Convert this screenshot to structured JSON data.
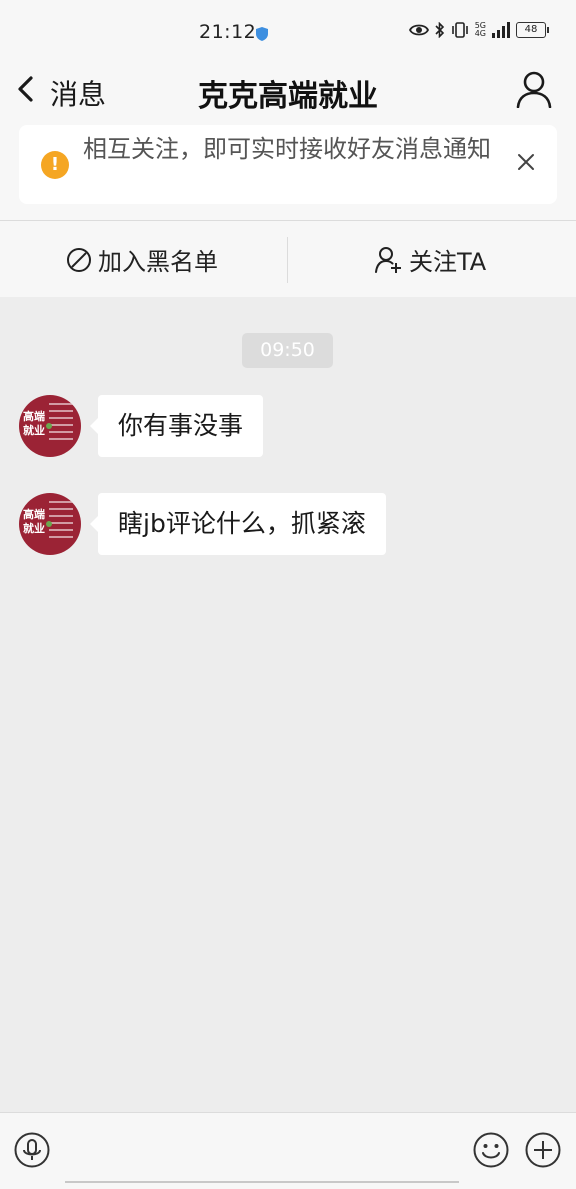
{
  "status_bar": {
    "time": "21:12",
    "network_label_top": "5G",
    "network_label_bottom": "4G",
    "battery": "48"
  },
  "nav": {
    "back_label": "消息",
    "title": "克克高端就业"
  },
  "notice": {
    "text": "相互关注，即可实时接收好友消息通知"
  },
  "actions": {
    "blacklist_label": "加入黑名单",
    "follow_label": "关注TA"
  },
  "chat": {
    "timestamp": "09:50",
    "messages": [
      {
        "text": "你有事没事"
      },
      {
        "text": "瞎jb评论什么，抓紧滚"
      }
    ]
  },
  "avatar": {
    "brand_text": "高端就业",
    "color": "#9b2335"
  },
  "input": {
    "placeholder": ""
  }
}
